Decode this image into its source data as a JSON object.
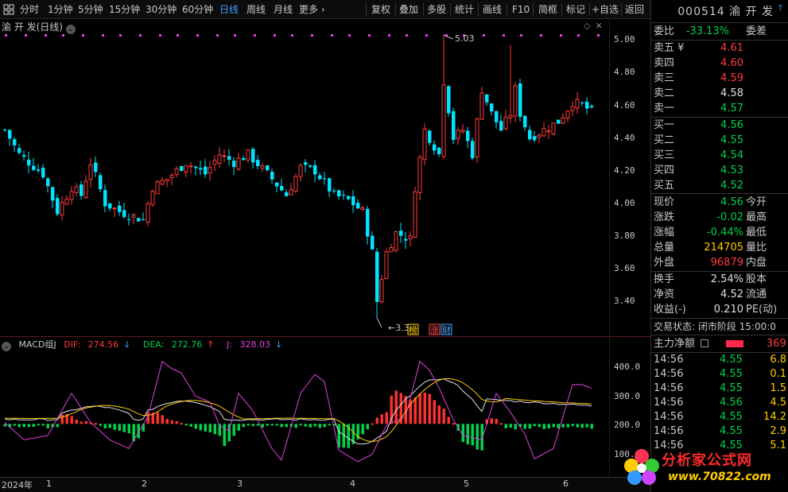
{
  "toolbar": {
    "items": [
      "分时",
      "1分钟",
      "5分钟",
      "15分钟",
      "30分钟",
      "60分钟",
      "日线",
      "周线",
      "月线",
      "更多 ›"
    ],
    "active": "日线",
    "tools": [
      "复权",
      "叠加",
      "多股",
      "统计",
      "画线",
      "F10",
      "简框",
      "标记",
      "+自选",
      "返回"
    ]
  },
  "chart": {
    "stock_title": "渝 开 发(日线)",
    "high_label": "5.03",
    "low_label": "3.30",
    "markers": [
      "榜",
      "涨",
      "财"
    ],
    "y_ticks": [
      "5.00",
      "4.80",
      "4.60",
      "4.40",
      "4.20",
      "4.00",
      "3.80",
      "3.60",
      "3.40"
    ],
    "x_labels": [
      "2024年",
      "1",
      "2",
      "3",
      "4",
      "5",
      "6"
    ]
  },
  "macd": {
    "name": "MACD组J",
    "dif_label": "DIF:",
    "dif": "274.56",
    "dea_label": "DEA:",
    "dea": "272.76",
    "j_label": "J:",
    "j": "328.03",
    "y_ticks": [
      "400.0",
      "300.0",
      "200.0",
      "100.0"
    ]
  },
  "quote": {
    "code_name": "000514 渝 开 发",
    "t_badge": "T",
    "weibi": {
      "label": "委比",
      "value": "-33.13%",
      "right": "委差"
    },
    "asks": [
      {
        "label": "卖五 ¥",
        "price": "4.61"
      },
      {
        "label": "卖四",
        "price": "4.60"
      },
      {
        "label": "卖三",
        "price": "4.59"
      },
      {
        "label": "卖二",
        "price": "4.58"
      },
      {
        "label": "卖一",
        "price": "4.57"
      }
    ],
    "bids": [
      {
        "label": "买一",
        "price": "4.56"
      },
      {
        "label": "买二",
        "price": "4.55"
      },
      {
        "label": "买三",
        "price": "4.54"
      },
      {
        "label": "买四",
        "price": "4.53"
      },
      {
        "label": "买五",
        "price": "4.52"
      }
    ],
    "stats": [
      {
        "label": "现价",
        "value": "4.56",
        "right": "今开"
      },
      {
        "label": "涨跌",
        "value": "-0.02",
        "right": "最高"
      },
      {
        "label": "涨幅",
        "value": "-0.44%",
        "right": "最低"
      },
      {
        "label": "总量",
        "value": "214705",
        "right": "量比"
      },
      {
        "label": "外盘",
        "value": "96879",
        "right": "内盘"
      }
    ],
    "stats2": [
      {
        "label": "换手",
        "value": "2.54%",
        "right": "股本"
      },
      {
        "label": "净资",
        "value": "4.52",
        "right": "流通"
      },
      {
        "label": "收益(-)",
        "value": "0.210",
        "right": "PE(动)"
      }
    ],
    "status": "交易状态: 闭市阶段 15:00:0",
    "net_flow_label": "主力净额",
    "net_flow_value": "369",
    "ticks": [
      {
        "time": "14:56",
        "price": "4.55",
        "vol": "6.8"
      },
      {
        "time": "14:56",
        "price": "4.55",
        "vol": "0.1"
      },
      {
        "time": "14:56",
        "price": "4.55",
        "vol": "1.5"
      },
      {
        "time": "14:56",
        "price": "4.56",
        "vol": "4.5"
      },
      {
        "time": "14:56",
        "price": "4.55",
        "vol": "14.2"
      },
      {
        "time": "14:56",
        "price": "4.55",
        "vol": "2.9"
      },
      {
        "time": "14:56",
        "price": "4.55",
        "vol": "5.1"
      }
    ]
  },
  "watermark": {
    "text1": "分析家公式网",
    "text2": "www.70822.com"
  },
  "colors": {
    "up": "#ff3b3b",
    "down": "#00e5ff",
    "dif": "#e0e0e0",
    "dea": "#ffcc00",
    "j": "#e040e0",
    "macd_up": "#ff3030",
    "macd_down": "#00d24a"
  }
}
